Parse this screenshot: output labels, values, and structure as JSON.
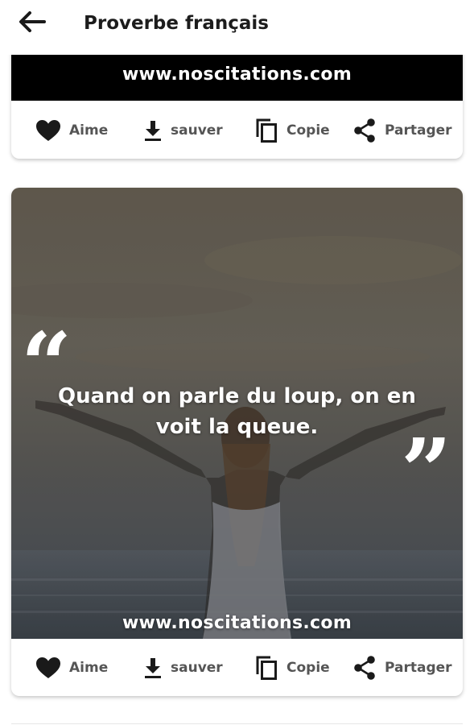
{
  "app_bar": {
    "title": "Proverbe français",
    "back_icon": "arrow-left-icon"
  },
  "cards": [
    {
      "site_url": "www.noscitations.com",
      "actions": {
        "like": "Aime",
        "save": "sauver",
        "copy": "Copie",
        "share": "Partager"
      }
    },
    {
      "quote": "Quand on parle du loup, on en voit la queue.",
      "open_quote_mark": "“",
      "close_quote_mark": "”",
      "site_url": "www.noscitations.com",
      "actions": {
        "like": "Aime",
        "save": "sauver",
        "copy": "Copie",
        "share": "Partager"
      }
    }
  ],
  "colors": {
    "text_dark": "#1c1c1c",
    "action_label": "#555555",
    "icon": "#1a1a1a",
    "card_image_bg": "#000000"
  }
}
